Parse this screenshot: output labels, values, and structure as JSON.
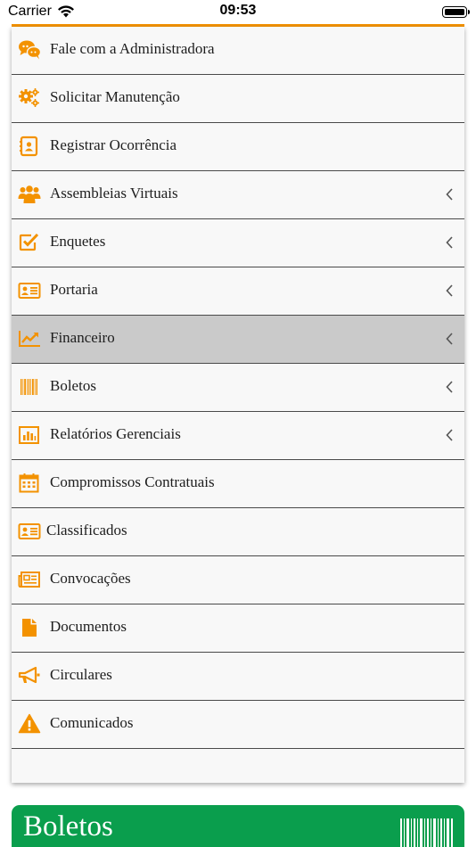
{
  "status_bar": {
    "carrier": "Carrier",
    "time": "09:53"
  },
  "theme": {
    "accent": "#f39200",
    "active_row": "#cacaca",
    "banner": "#0a9e4d"
  },
  "menu": {
    "items": [
      {
        "label": "Fale com a Administradora",
        "icon": "chat-bubbles-icon",
        "expandable": false,
        "active": false
      },
      {
        "label": "Solicitar Manutenção",
        "icon": "gears-icon",
        "expandable": false,
        "active": false
      },
      {
        "label": "Registrar Ocorrência",
        "icon": "contact-book-icon",
        "expandable": false,
        "active": false
      },
      {
        "label": "Assembleias Virtuais",
        "icon": "users-group-icon",
        "expandable": true,
        "active": false
      },
      {
        "label": "Enquetes",
        "icon": "checkbox-icon",
        "expandable": true,
        "active": false
      },
      {
        "label": "Portaria",
        "icon": "id-card-icon",
        "expandable": true,
        "active": false
      },
      {
        "label": "Financeiro",
        "icon": "line-chart-icon",
        "expandable": true,
        "active": true
      },
      {
        "label": "Boletos",
        "icon": "barcode-icon",
        "expandable": true,
        "active": false
      },
      {
        "label": "Relatórios Gerenciais",
        "icon": "bar-chart-icon",
        "expandable": true,
        "active": false
      },
      {
        "label": "Compromissos Contratuais",
        "icon": "calendar-icon",
        "expandable": false,
        "active": false
      },
      {
        "label": "Classificados",
        "icon": "id-card-icon",
        "expandable": false,
        "active": false
      },
      {
        "label": "Convocações",
        "icon": "newspaper-icon",
        "expandable": false,
        "active": false
      },
      {
        "label": "Documentos",
        "icon": "document-icon",
        "expandable": false,
        "active": false
      },
      {
        "label": "Circulares",
        "icon": "megaphone-icon",
        "expandable": false,
        "active": false
      },
      {
        "label": "Comunicados",
        "icon": "warning-icon",
        "expandable": false,
        "active": false
      }
    ]
  },
  "banner": {
    "title": "Boletos",
    "icon": "barcode-icon"
  }
}
